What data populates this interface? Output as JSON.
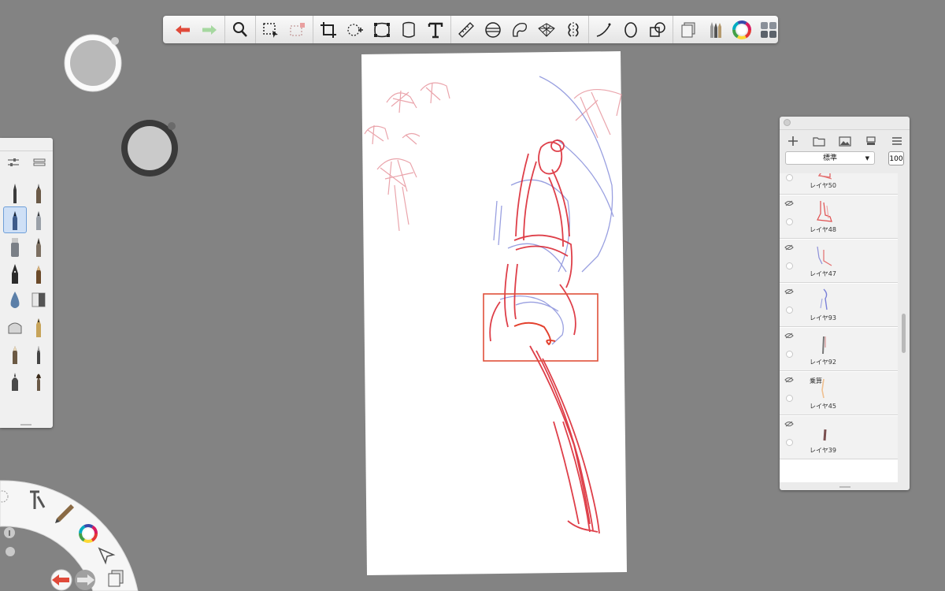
{
  "app": {
    "background": "#838383"
  },
  "toolbar": {
    "groups": [
      [
        "undo-icon",
        "redo-icon"
      ],
      [
        "zoom-icon"
      ],
      [
        "selection-icon",
        "clear-selection-icon"
      ],
      [
        "crop-icon",
        "transform-icon",
        "distort-icon",
        "fill-icon",
        "text-icon"
      ],
      [
        "ruler-icon",
        "ellipse-guide-icon",
        "french-curve-icon",
        "perspective-icon",
        "symmetry-icon"
      ],
      [
        "stroke-tool-icon",
        "shape-ellipse-icon",
        "shape-tool-icon"
      ],
      [
        "layer-editor-icon",
        "brush-library-icon",
        "color-editor-icon",
        "copic-library-icon"
      ]
    ]
  },
  "pucks": {
    "light_color": "#b9b9b9",
    "dark_color": "#cacaca"
  },
  "brushes": [
    "pencil-brush",
    "ballpoint-brush",
    "airbrush-brush",
    "paint-brush",
    "marker-brush",
    "chisel-brush",
    "fountain-pen-brush",
    "felt-tip-brush",
    "blender-brush",
    "eraser-brush",
    "smear-brush",
    "hard-pencil-brush",
    "ink-brush",
    "wash-brush",
    "fine-pen-brush",
    "round-brush"
  ],
  "selected_brush": 2,
  "layers": {
    "blend_mode": "標準",
    "opacity": "100",
    "items": [
      {
        "name": "レイヤ50",
        "tag": ""
      },
      {
        "name": "レイヤ48",
        "tag": ""
      },
      {
        "name": "レイヤ47",
        "tag": ""
      },
      {
        "name": "レイヤ93",
        "tag": ""
      },
      {
        "name": "レイヤ92",
        "tag": ""
      },
      {
        "name": "レイヤ45",
        "tag": "乗算"
      },
      {
        "name": "レイヤ39",
        "tag": ""
      }
    ]
  },
  "lagoon": {
    "undo": "undo-icon",
    "redo": "redo-icon",
    "color_wheel": "color-wheel-icon"
  }
}
